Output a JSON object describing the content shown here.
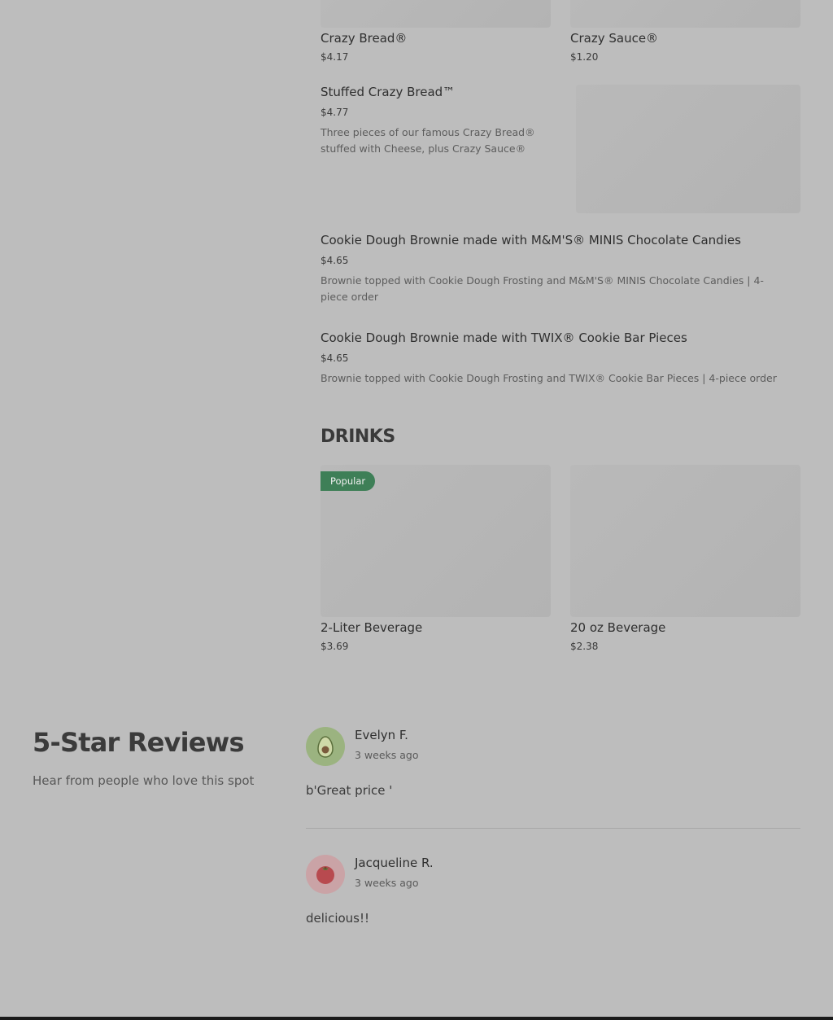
{
  "menu": {
    "top_items": [
      {
        "name": "Crazy Bread®",
        "price": "$4.17"
      },
      {
        "name": "Crazy Sauce®",
        "price": "$1.20"
      }
    ],
    "list_items": [
      {
        "name": "Stuffed Crazy Bread™",
        "price": "$4.77",
        "desc_line1": "Three pieces of our famous Crazy Bread®",
        "desc_line2": "stuffed with Cheese, plus Crazy Sauce®"
      },
      {
        "name": "Cookie Dough Brownie made with M&M'S® MINIS Chocolate Candies",
        "price": "$4.65",
        "desc_line1": "Brownie topped with Cookie Dough Frosting and M&M'S® MINIS Chocolate Candies | 4-",
        "desc_line2": "piece order"
      },
      {
        "name": "Cookie Dough Brownie made with TWIX® Cookie Bar Pieces",
        "price": "$4.65",
        "desc_line1": "Brownie topped with Cookie Dough Frosting and TWIX® Cookie Bar Pieces | 4-piece order"
      }
    ],
    "drinks": {
      "title": "DRINKS",
      "items": [
        {
          "name": "2-Liter Beverage",
          "price": "$3.69",
          "badge": "Popular"
        },
        {
          "name": "20 oz Beverage",
          "price": "$2.38"
        }
      ]
    }
  },
  "reviews": {
    "title": "5-Star Reviews",
    "subtitle": "Hear from people who love this spot",
    "items": [
      {
        "name": "Evelyn F.",
        "when": "3 weeks ago",
        "text": "b'Great price '",
        "avatar_icon": "avocado-icon"
      },
      {
        "name": "Jacqueline R.",
        "when": "3 weeks ago",
        "text": "delicious!!",
        "avatar_icon": "tomato-icon"
      }
    ]
  },
  "colors": {
    "overlay_bg": "#bdbdbd",
    "badge_green": "#3e7f57",
    "avocado_bg": "#9bb380",
    "tomato_bg": "#caa3a6"
  }
}
